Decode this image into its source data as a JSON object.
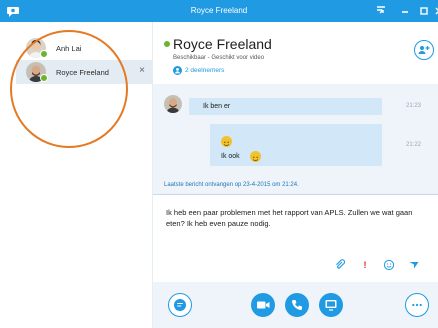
{
  "window": {
    "title": "Royce Freeland"
  },
  "sidebar": {
    "contacts": [
      {
        "name": "Anh Lai",
        "selected": false
      },
      {
        "name": "Royce Freeland",
        "selected": true,
        "close_label": "×"
      }
    ]
  },
  "header": {
    "name": "Royce Freeland",
    "status": "Beschikbaar - Geschikt voor video",
    "participants": "2 deelnemers"
  },
  "conversation": {
    "messages": [
      {
        "text": "Ik ben er",
        "time": "21:23"
      },
      {
        "text": "Ik ook",
        "time": "21:22"
      }
    ],
    "last_received": "Laatste bericht ontvangen op 23-4-2015 om 21:24."
  },
  "compose": {
    "text": "Ik heb een paar problemen met het rapport van APLS. Zullen we wat gaan eten? Ik heb even pauze nodig."
  },
  "colors": {
    "accent": "#1f9ae3",
    "presence": "#6bb42f",
    "annotation": "#e57a25",
    "urgent": "#d62a2a"
  }
}
